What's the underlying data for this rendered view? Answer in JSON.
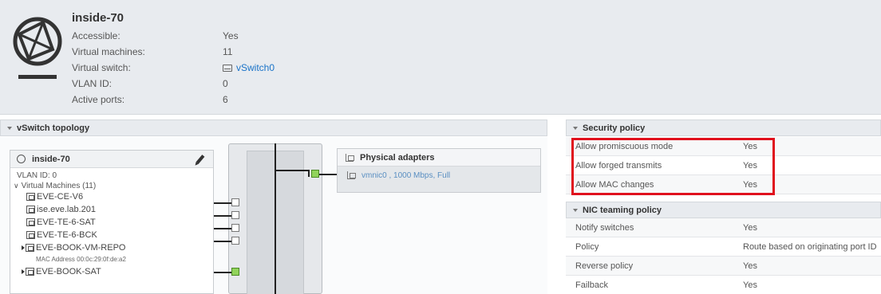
{
  "header": {
    "title": "inside-70",
    "fields": [
      {
        "label": "Accessible:",
        "value": "Yes"
      },
      {
        "label": "Virtual machines:",
        "value": "11"
      },
      {
        "label": "Virtual switch:",
        "value": "vSwitch0"
      },
      {
        "label": "VLAN ID:",
        "value": "0"
      },
      {
        "label": "Active ports:",
        "value": "6"
      }
    ]
  },
  "topology": {
    "title": "vSwitch topology",
    "port_group": {
      "name": "inside-70",
      "vlan": "VLAN ID: 0",
      "vms_label": "Virtual Machines (11)",
      "vms": [
        "EVE-CE-V6",
        "ise.eve.lab.201",
        "EVE-TE-6-SAT",
        "EVE-TE-6-BCK",
        "EVE-BOOK-VM-REPO",
        "EVE-BOOK-SAT"
      ],
      "mac": "MAC Address 00:0c:29:0f:de:a2"
    },
    "physical": {
      "title": "Physical adapters",
      "adapter": "vmnic0 , 1000 Mbps, Full"
    }
  },
  "security": {
    "title": "Security policy",
    "rows": [
      {
        "label": "Allow promiscuous mode",
        "value": "Yes"
      },
      {
        "label": "Allow forged transmits",
        "value": "Yes"
      },
      {
        "label": "Allow MAC changes",
        "value": "Yes"
      }
    ]
  },
  "nic": {
    "title": "NIC teaming policy",
    "rows": [
      {
        "label": "Notify switches",
        "value": "Yes"
      },
      {
        "label": "Policy",
        "value": "Route based on originating port ID"
      },
      {
        "label": "Reverse policy",
        "value": "Yes"
      },
      {
        "label": "Failback",
        "value": "Yes"
      }
    ]
  },
  "colors": {
    "highlight": "#e0101d",
    "link": "#1a73c8",
    "active_port": "#91d35a"
  }
}
